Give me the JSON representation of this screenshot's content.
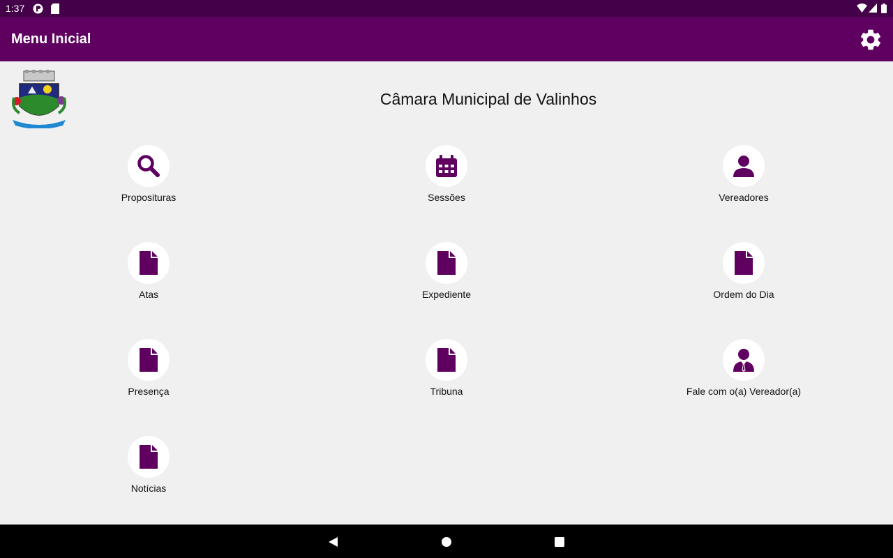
{
  "status_bar": {
    "time": "1:37"
  },
  "app_bar": {
    "title": "Menu Inicial"
  },
  "header": {
    "title": "Câmara Municipal de Valinhos"
  },
  "menu": {
    "items": [
      {
        "label": "Proposituras",
        "icon": "search-icon"
      },
      {
        "label": "Sessões",
        "icon": "calendar-icon"
      },
      {
        "label": "Vereadores",
        "icon": "person-icon"
      },
      {
        "label": "Atas",
        "icon": "document-icon"
      },
      {
        "label": "Expediente",
        "icon": "document-icon"
      },
      {
        "label": "Ordem do Dia",
        "icon": "document-icon"
      },
      {
        "label": "Presença",
        "icon": "document-icon"
      },
      {
        "label": "Tribuna",
        "icon": "document-icon"
      },
      {
        "label": "Fale com o(a) Vereador(a)",
        "icon": "person-tie-icon"
      },
      {
        "label": "Notícias",
        "icon": "document-icon"
      }
    ]
  },
  "colors": {
    "primary": "#5f0060",
    "status_bar": "#45004a",
    "background": "#f0f0f0",
    "icon": "#5f0060"
  }
}
